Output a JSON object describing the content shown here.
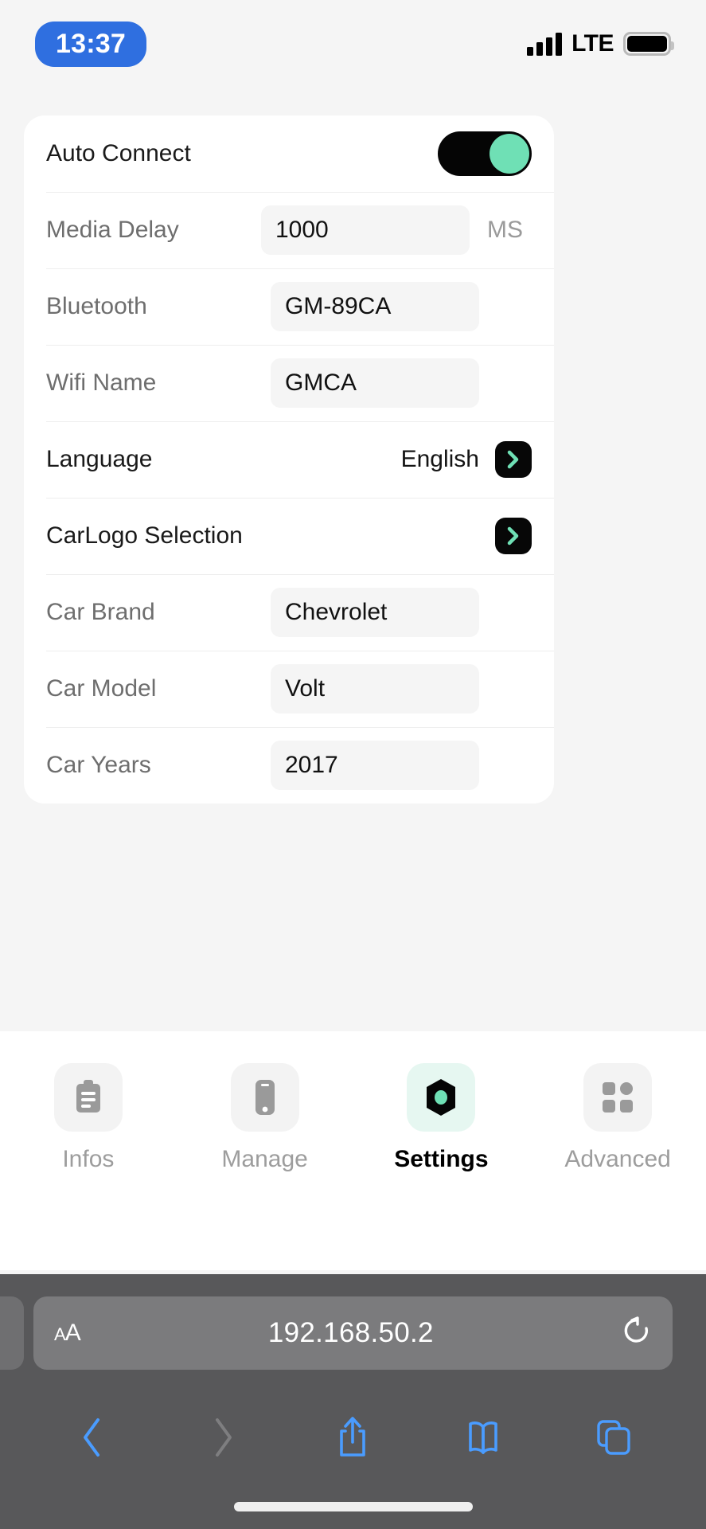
{
  "status_bar": {
    "time": "13:37",
    "carrier": "LTE",
    "signal_icon": "signal-bars-icon",
    "battery_icon": "battery-icon"
  },
  "settings": {
    "rows": [
      {
        "label": "Auto Connect",
        "type": "toggle",
        "value": "on",
        "label_style": "dark"
      },
      {
        "label": "Media Delay",
        "type": "input",
        "value": "1000",
        "unit": "MS",
        "label_style": "gray"
      },
      {
        "label": "Bluetooth",
        "type": "input",
        "value": "GM-89CA",
        "label_style": "gray"
      },
      {
        "label": "Wifi Name",
        "type": "input",
        "value": "GMCA",
        "label_style": "gray"
      },
      {
        "label": "Language",
        "type": "nav",
        "value": "English",
        "label_style": "dark"
      },
      {
        "label": "CarLogo Selection",
        "type": "nav",
        "value": "",
        "label_style": "dark"
      },
      {
        "label": "Car Brand",
        "type": "input",
        "value": "Chevrolet",
        "label_style": "gray"
      },
      {
        "label": "Car Model",
        "type": "input",
        "value": "Volt",
        "label_style": "gray"
      },
      {
        "label": "Car Years",
        "type": "input",
        "value": "2017",
        "label_style": "gray"
      }
    ]
  },
  "tabbar": {
    "tabs": [
      {
        "label": "Infos",
        "icon": "clipboard-icon",
        "active": false
      },
      {
        "label": "Manage",
        "icon": "phone-icon",
        "active": false
      },
      {
        "label": "Settings",
        "icon": "gear-nut-icon",
        "active": true
      },
      {
        "label": "Advanced",
        "icon": "grid-icon",
        "active": false
      }
    ]
  },
  "browser": {
    "url": "192.168.50.2",
    "text_size_label": "AA",
    "reload_icon": "reload-icon",
    "toolbar": [
      {
        "name": "back-button",
        "icon": "chevron-left-icon",
        "enabled": true
      },
      {
        "name": "forward-button",
        "icon": "chevron-right-icon",
        "enabled": false
      },
      {
        "name": "share-button",
        "icon": "share-icon",
        "enabled": true
      },
      {
        "name": "bookmarks-button",
        "icon": "book-icon",
        "enabled": true
      },
      {
        "name": "tabs-button",
        "icon": "tabs-icon",
        "enabled": true
      }
    ]
  },
  "colors": {
    "accent_mint": "#6fe0b5",
    "toggle_track": "#050505",
    "safari_chrome": "#58585a",
    "url_pill": "#7b7b7d",
    "safari_blue": "#4a9cff",
    "time_pill_blue": "#2f6fe0"
  }
}
